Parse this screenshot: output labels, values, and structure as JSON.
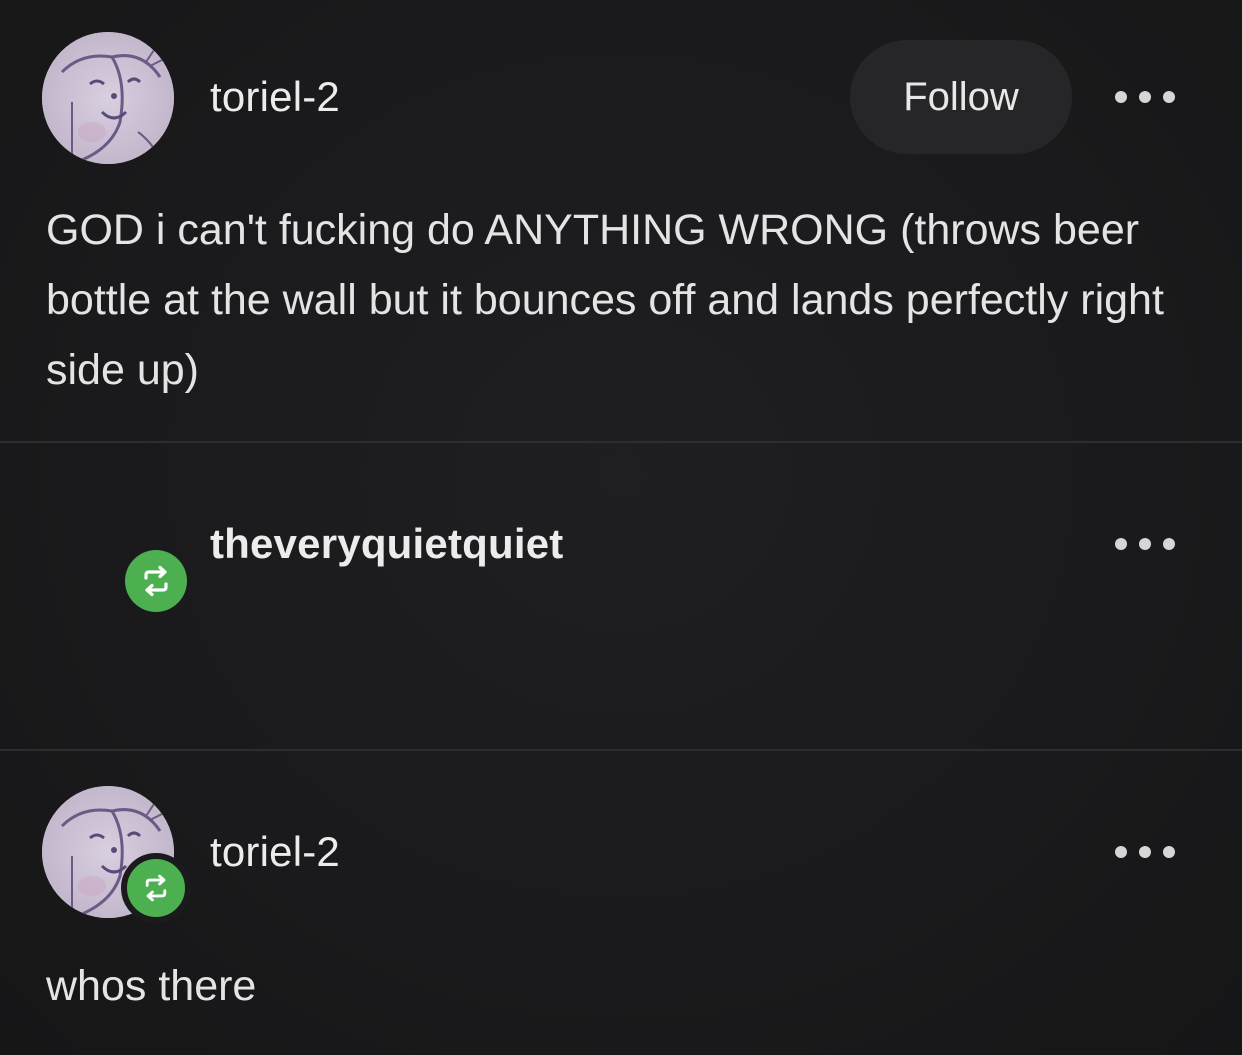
{
  "posts": [
    {
      "username": "toriel-2",
      "follow_label": "Follow",
      "body": "GOD i can't fucking do ANYTHING WRONG (throws beer bottle at the wall but it bounces off and lands perfectly right side up)"
    },
    {
      "username": "theveryquietquiet"
    },
    {
      "username": "toriel-2",
      "body": "whos there"
    }
  ],
  "colors": {
    "background": "#1b1b1d",
    "reblog_green": "#4caf50",
    "follow_button": "#262628"
  },
  "icons": {
    "reblog": "reblog-icon",
    "more": "more-options-icon"
  }
}
